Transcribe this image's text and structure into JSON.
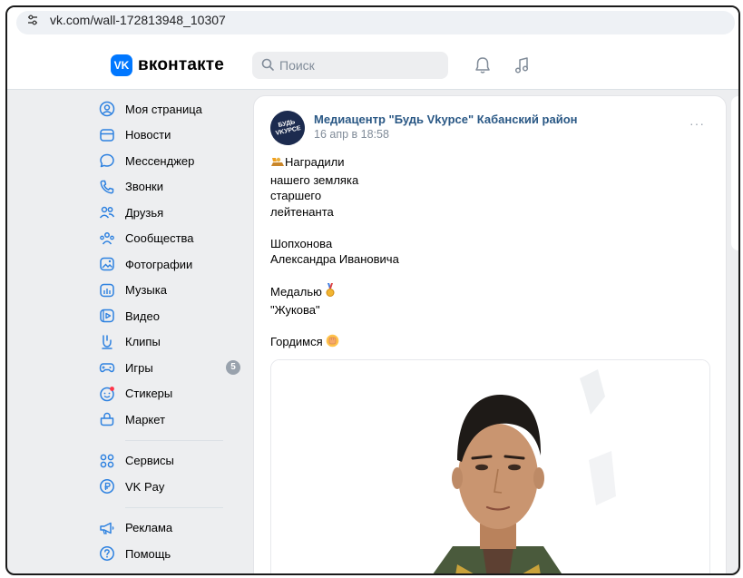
{
  "browser": {
    "url": "vk.com/wall-172813948_10307"
  },
  "header": {
    "logo_text": "вконтакте",
    "logo_glyph": "VK",
    "search_placeholder": "Поиск"
  },
  "sidebar": {
    "items": [
      {
        "label": "Моя страница",
        "icon": "user-circle-icon"
      },
      {
        "label": "Новости",
        "icon": "news-icon"
      },
      {
        "label": "Мессенджер",
        "icon": "message-bubble-icon"
      },
      {
        "label": "Звонки",
        "icon": "phone-icon"
      },
      {
        "label": "Друзья",
        "icon": "friends-icon"
      },
      {
        "label": "Сообщества",
        "icon": "communities-icon"
      },
      {
        "label": "Фотографии",
        "icon": "photos-icon"
      },
      {
        "label": "Музыка",
        "icon": "music-icon"
      },
      {
        "label": "Видео",
        "icon": "video-icon"
      },
      {
        "label": "Клипы",
        "icon": "clips-icon"
      },
      {
        "label": "Игры",
        "icon": "games-icon",
        "badge": "5"
      },
      {
        "label": "Стикеры",
        "icon": "stickers-icon"
      },
      {
        "label": "Маркет",
        "icon": "market-bag-icon"
      }
    ],
    "items2": [
      {
        "label": "Сервисы",
        "icon": "services-icon"
      },
      {
        "label": "VK Pay",
        "icon": "vkpay-icon"
      }
    ],
    "items3": [
      {
        "label": "Реклама",
        "icon": "megaphone-icon"
      },
      {
        "label": "Помощь",
        "icon": "help-icon"
      }
    ]
  },
  "post": {
    "avatar_text": "БУДЬ VKУРСЕ",
    "author": "Медиацентр \"Будь Vkурсе\" Кабанский район",
    "date": "16 апр в 18:58",
    "more": "···",
    "lines": [
      "Наградили",
      "нашего земляка",
      "старшего",
      "лейтенанта",
      "",
      "Шопхонова",
      "Александра Ивановича",
      "",
      "Медалью",
      "\"Жукова\"",
      "",
      "Гордимся"
    ]
  },
  "colors": {
    "accent": "#0077ff",
    "link": "#2a5885",
    "icon": "#2d81e0",
    "muted": "#818c99",
    "badge": "#99a2ad"
  }
}
